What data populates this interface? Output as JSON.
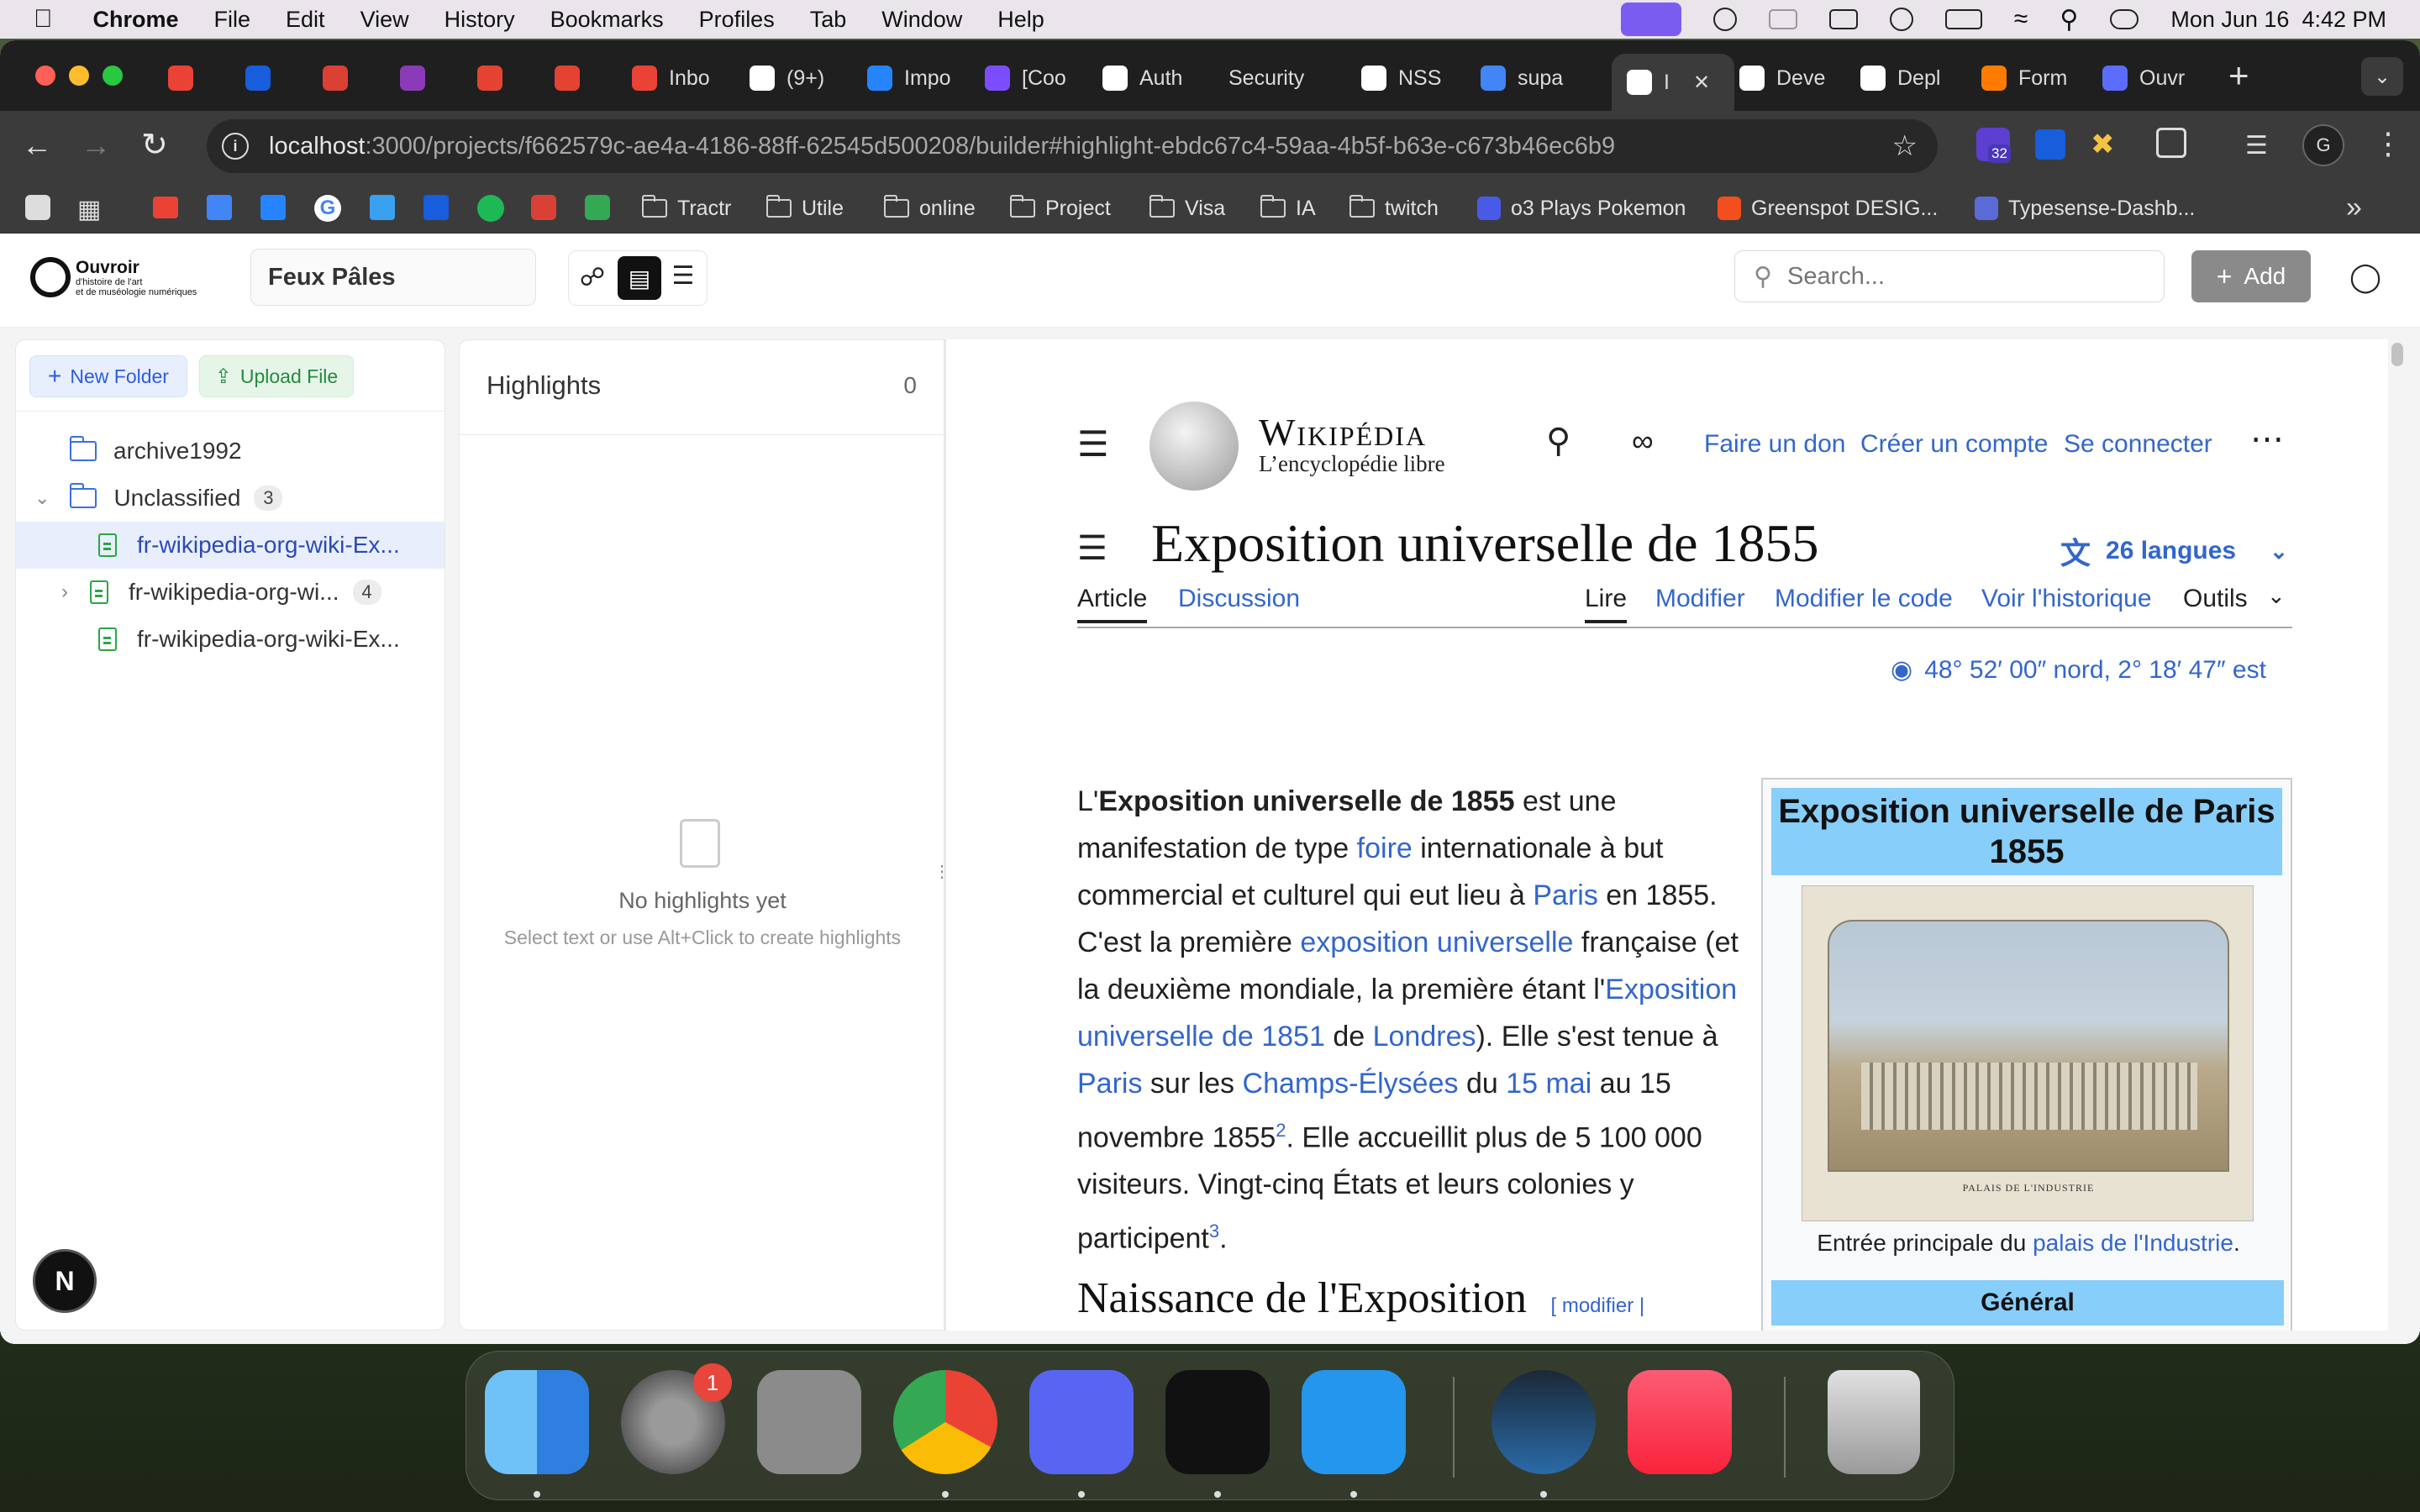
{
  "menubar": {
    "app_name": "Chrome",
    "items": [
      "File",
      "Edit",
      "View",
      "History",
      "Bookmarks",
      "Profiles",
      "Tab",
      "Window",
      "Help"
    ],
    "clock": "Mon Jun 16  4:42 PM"
  },
  "tabs": [
    {
      "label": "",
      "icon": "gmail-icon",
      "color": "#ea4335"
    },
    {
      "label": "",
      "icon": "bitwarden-icon",
      "color": "#175ddc"
    },
    {
      "label": "",
      "icon": "todoist-icon",
      "color": "#db4035"
    },
    {
      "label": "",
      "icon": "app-icon",
      "color": "#8a3ab9"
    },
    {
      "label": "",
      "icon": "calendar-icon",
      "color": "#e44332"
    },
    {
      "label": "",
      "icon": "calendar-icon",
      "color": "#e44332"
    },
    {
      "label": "Inbo",
      "icon": "gmail-icon",
      "color": "#ea4335"
    },
    {
      "label": "(9+)",
      "icon": "notion-icon",
      "color": "#ffffff"
    },
    {
      "label": "Impo",
      "icon": "atlassian-icon",
      "color": "#2684ff"
    },
    {
      "label": "[Coo",
      "icon": "c-icon",
      "color": "#7c4dff"
    },
    {
      "label": "Auth",
      "icon": "github-icon",
      "color": "#ffffff"
    },
    {
      "label": "Security",
      "icon": "",
      "color": ""
    },
    {
      "label": "NSS",
      "icon": "vercel-icon",
      "color": "#ffffff"
    },
    {
      "label": "supa",
      "icon": "google-icon",
      "color": "#4285f4"
    },
    {
      "label": "I",
      "icon": "vercel-icon",
      "color": "#ffffff",
      "active": true
    },
    {
      "label": "Deve",
      "icon": "github-icon",
      "color": "#ffffff"
    },
    {
      "label": "Depl",
      "icon": "github-icon",
      "color": "#ffffff"
    },
    {
      "label": "Form",
      "icon": "ring-icon",
      "color": "#ff7a00"
    },
    {
      "label": "Ouvr",
      "icon": "gear-icon",
      "color": "#5b6cff"
    }
  ],
  "address": {
    "host": "localhost",
    "rest": ":3000/projects/f662579c-ae4a-4186-88ff-62545d500208/builder#highlight-ebdc67c4-59aa-4b5f-b63e-c673b46ec6b9",
    "extension_badge": "32",
    "profile_initial": "G"
  },
  "bookmarks": [
    {
      "label": "Tractr",
      "type": "folder"
    },
    {
      "label": "Utile",
      "type": "folder"
    },
    {
      "label": "online",
      "type": "folder"
    },
    {
      "label": "Project",
      "type": "folder"
    },
    {
      "label": "Visa",
      "type": "folder"
    },
    {
      "label": "IA",
      "type": "folder"
    },
    {
      "label": "twitch",
      "type": "folder"
    },
    {
      "label": "o3 Plays Pokemon",
      "type": "page"
    },
    {
      "label": "Greenspot DESIG...",
      "type": "page"
    },
    {
      "label": "Typesense-Dashb...",
      "type": "page"
    }
  ],
  "app": {
    "logo_title": "Ouvroir",
    "logo_sub1": "d'histoire de l'art",
    "logo_sub2": "et de muséologie numériques",
    "project_name": "Feux Pâles",
    "search_placeholder": "Search...",
    "add_label": "Add"
  },
  "sidebar": {
    "new_folder": "New Folder",
    "upload_file": "Upload File",
    "tree": [
      {
        "label": "archive1992",
        "type": "folder",
        "level": 0
      },
      {
        "label": "Unclassified",
        "type": "folder-open",
        "level": 0,
        "count": "3"
      },
      {
        "label": "fr-wikipedia-org-wiki-Ex...",
        "type": "file",
        "level": 1,
        "selected": true
      },
      {
        "label": "fr-wikipedia-org-wi...",
        "type": "file",
        "level": 1,
        "count": "4"
      },
      {
        "label": "fr-wikipedia-org-wiki-Ex...",
        "type": "file",
        "level": 1
      }
    ]
  },
  "highlights": {
    "title": "Highlights",
    "count": "0",
    "empty_title": "No highlights yet",
    "empty_hint": "Select text or use Alt+Click to create highlights"
  },
  "wiki": {
    "brand": "Wikipédia",
    "tagline": "L’encyclopédie libre",
    "header_links": [
      "Faire un don",
      "Créer un compte",
      "Se connecter"
    ],
    "title": "Exposition universelle de 1855",
    "languages": "26 langues",
    "tabs_left": [
      "Article",
      "Discussion"
    ],
    "tabs_right": [
      "Lire",
      "Modifier",
      "Modifier le code",
      "Voir l'historique",
      "Outils"
    ],
    "coordinates": "48° 52′ 00″ nord, 2° 18′ 47″ est",
    "paragraph": {
      "p1": "L'",
      "bold": "Exposition universelle de 1855",
      "p2": " est une manifestation de type ",
      "l1": "foire",
      "p3": " internationale à but commercial et culturel qui eut lieu à ",
      "l2": "Paris",
      "p4": " en 1855. C'est la première ",
      "l3": "exposition universelle",
      "p5": " française (et la deuxième mondiale, la première étant l'",
      "l4": "Exposition universelle de 1851",
      "p6": " de ",
      "l5": "Londres",
      "p7": "). Elle s'est tenue à ",
      "l6": "Paris",
      "p8": " sur les ",
      "l7": "Champs-Élysées",
      "p9": " du ",
      "l8": "15 mai",
      "p10": " au 15 novembre 1855",
      "ref1": "2",
      "p11": ". Elle accueillit plus de 5 100 000 visiteurs. Vingt-cinq États et leurs colonies y participent",
      "ref2": "3",
      "p12": "."
    },
    "next_heading": "Naissance de l'Exposition",
    "next_heading_edit": "[ modifier |",
    "infobox": {
      "title": "Exposition universelle de Paris 1855",
      "caption_prefix": "Entrée principale du ",
      "caption_link": "palais de l'Industrie",
      "caption_suffix": ".",
      "engraving_title": "PALAIS DE L'INDUSTRIE",
      "section": "Général"
    }
  },
  "dock": {
    "apps": [
      "finder-icon",
      "system-settings-icon",
      "launchpad-icon",
      "chrome-icon",
      "discord-icon",
      "unity-icon",
      "docker-icon",
      "steam-icon",
      "music-icon",
      "trash-icon"
    ],
    "settings_badge": "1"
  }
}
